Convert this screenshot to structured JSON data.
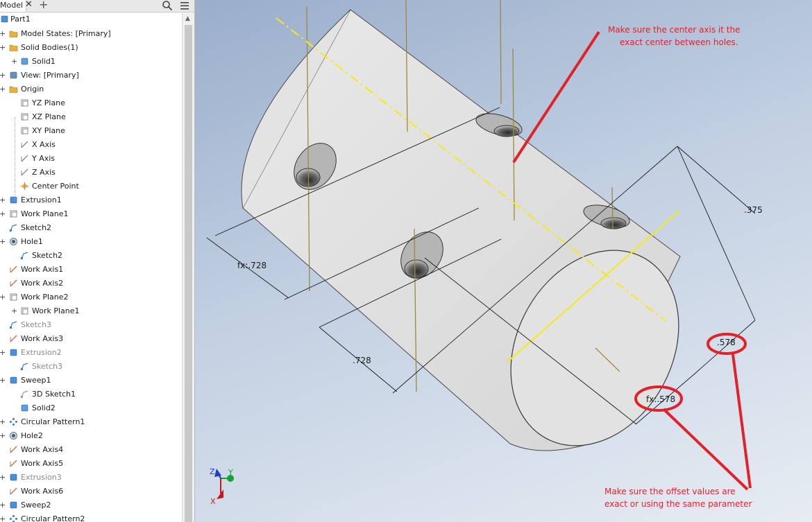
{
  "browser": {
    "tab_label": "Model",
    "tab_close": "✕",
    "tab_add": "+",
    "search_icon": "search-icon",
    "menu_icon": "hamburger-menu-icon",
    "tree": [
      {
        "label": "Part1",
        "icon": "part-icon"
      },
      {
        "label": "Model States: [Primary]",
        "icon": "folder-icon"
      },
      {
        "label": "Solid Bodies(1)",
        "icon": "folder-open-icon"
      },
      {
        "label": "Solid1",
        "icon": "solid-body-icon"
      },
      {
        "label": "View: [Primary]",
        "icon": "view-icon"
      },
      {
        "label": "Origin",
        "icon": "folder-open-icon"
      },
      {
        "label": "YZ Plane",
        "icon": "plane-icon"
      },
      {
        "label": "XZ Plane",
        "icon": "plane-icon"
      },
      {
        "label": "XY Plane",
        "icon": "plane-icon"
      },
      {
        "label": "X Axis",
        "icon": "axis-icon"
      },
      {
        "label": "Y Axis",
        "icon": "axis-icon"
      },
      {
        "label": "Z Axis",
        "icon": "axis-icon"
      },
      {
        "label": "Center Point",
        "icon": "center-point-icon"
      },
      {
        "label": "Extrusion1",
        "icon": "extrusion-icon"
      },
      {
        "label": "Work Plane1",
        "icon": "work-plane-icon"
      },
      {
        "label": "Sketch2",
        "icon": "sketch-icon"
      },
      {
        "label": "Hole1",
        "icon": "hole-icon"
      },
      {
        "label": "Sketch2",
        "icon": "sketch-icon"
      },
      {
        "label": "Work Axis1",
        "icon": "work-axis-icon"
      },
      {
        "label": "Work Axis2",
        "icon": "work-axis-icon"
      },
      {
        "label": "Work Plane2",
        "icon": "work-plane-icon"
      },
      {
        "label": "Work Plane1",
        "icon": "work-plane-icon"
      },
      {
        "label": "Sketch3",
        "icon": "sketch-icon"
      },
      {
        "label": "Work Axis3",
        "icon": "work-axis-icon"
      },
      {
        "label": "Extrusion2",
        "icon": "extrusion-icon"
      },
      {
        "label": "Sketch3",
        "icon": "sketch-icon"
      },
      {
        "label": "Sweep1",
        "icon": "sweep-icon"
      },
      {
        "label": "3D Sketch1",
        "icon": "3d-sketch-icon"
      },
      {
        "label": "Solid2",
        "icon": "solid-body-icon"
      },
      {
        "label": "Circular Pattern1",
        "icon": "circular-pattern-icon"
      },
      {
        "label": "Hole2",
        "icon": "hole-icon"
      },
      {
        "label": "Work Axis4",
        "icon": "work-axis-icon"
      },
      {
        "label": "Work Axis5",
        "icon": "work-axis-icon"
      },
      {
        "label": "Extrusion3",
        "icon": "extrusion-icon"
      },
      {
        "label": "Work Axis6",
        "icon": "work-axis-icon"
      },
      {
        "label": "Sweep2",
        "icon": "sweep-icon"
      },
      {
        "label": "Circular Pattern2",
        "icon": "circular-pattern-icon"
      }
    ]
  },
  "viewport": {
    "dimensions": {
      "dim_375": ".375",
      "dim_728_left": "fx:.728",
      "dim_728_bottom": ".728",
      "dim_578": ".578",
      "dim_578_fx": "fx:.578"
    },
    "annotations": {
      "top_note_line1": "Make sure the center axis it the",
      "top_note_line2": "exact center between holes.",
      "bottom_note_line1": "Make sure the offset values are",
      "bottom_note_line2": "exact or using the same parameter"
    },
    "view_cube": {
      "x": "X",
      "y": "Y",
      "z": "Z"
    },
    "colors": {
      "annotation_red": "#e0222b",
      "axis_yellow": "#f5ea16",
      "body_gray": "#dcdcdc",
      "work_axis_olive": "#9b8a3a"
    }
  }
}
